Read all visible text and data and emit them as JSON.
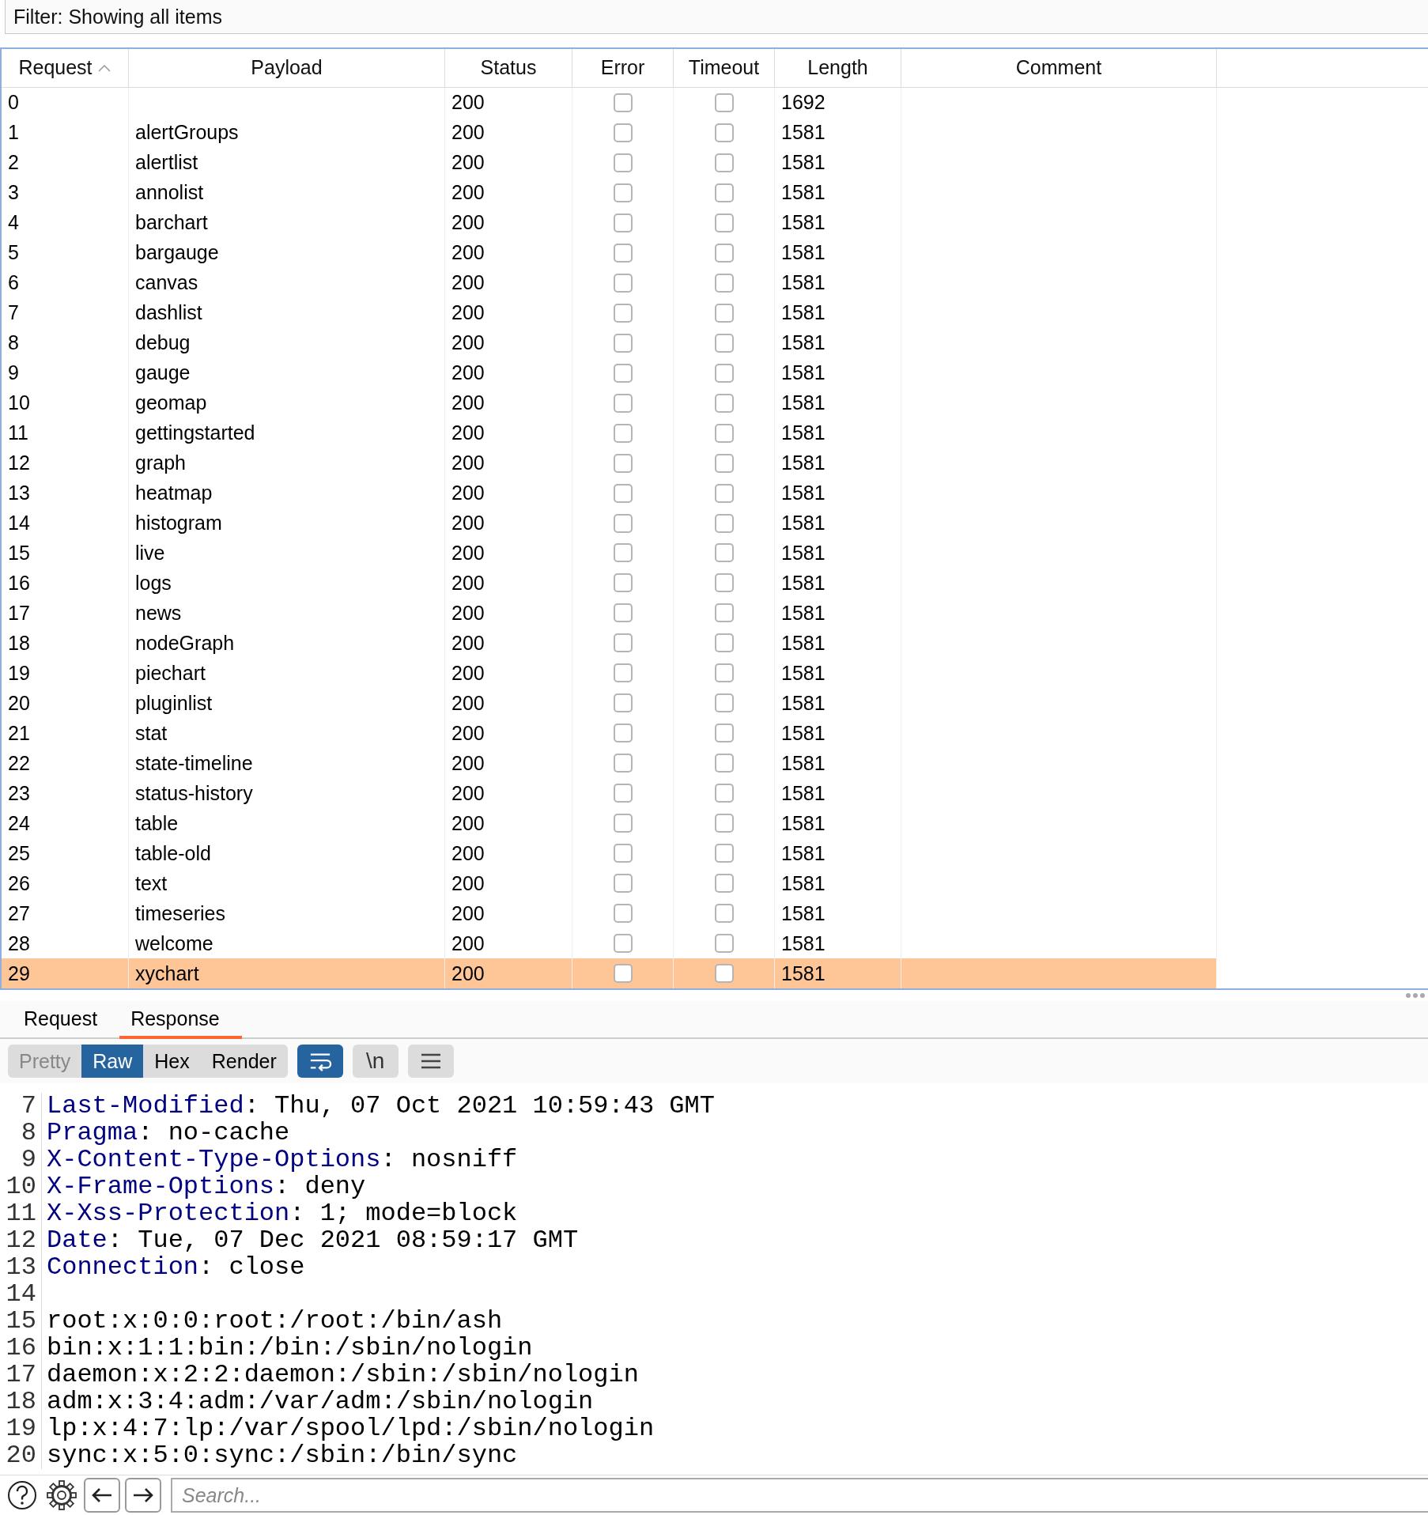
{
  "filter": {
    "label": "Filter: Showing all items"
  },
  "table": {
    "columns": [
      {
        "label": "Request",
        "sorted": true
      },
      {
        "label": "Payload",
        "sorted": false
      },
      {
        "label": "Status",
        "sorted": false
      },
      {
        "label": "Error",
        "sorted": false
      },
      {
        "label": "Timeout",
        "sorted": false
      },
      {
        "label": "Length",
        "sorted": false
      },
      {
        "label": "Comment",
        "sorted": false
      }
    ],
    "rows": [
      {
        "request": "0",
        "payload": "",
        "status": "200",
        "error": false,
        "timeout": false,
        "length": "1692",
        "selected": false
      },
      {
        "request": "1",
        "payload": "alertGroups",
        "status": "200",
        "error": false,
        "timeout": false,
        "length": "1581",
        "selected": false
      },
      {
        "request": "2",
        "payload": "alertlist",
        "status": "200",
        "error": false,
        "timeout": false,
        "length": "1581",
        "selected": false
      },
      {
        "request": "3",
        "payload": "annolist",
        "status": "200",
        "error": false,
        "timeout": false,
        "length": "1581",
        "selected": false
      },
      {
        "request": "4",
        "payload": "barchart",
        "status": "200",
        "error": false,
        "timeout": false,
        "length": "1581",
        "selected": false
      },
      {
        "request": "5",
        "payload": "bargauge",
        "status": "200",
        "error": false,
        "timeout": false,
        "length": "1581",
        "selected": false
      },
      {
        "request": "6",
        "payload": "canvas",
        "status": "200",
        "error": false,
        "timeout": false,
        "length": "1581",
        "selected": false
      },
      {
        "request": "7",
        "payload": "dashlist",
        "status": "200",
        "error": false,
        "timeout": false,
        "length": "1581",
        "selected": false
      },
      {
        "request": "8",
        "payload": "debug",
        "status": "200",
        "error": false,
        "timeout": false,
        "length": "1581",
        "selected": false
      },
      {
        "request": "9",
        "payload": "gauge",
        "status": "200",
        "error": false,
        "timeout": false,
        "length": "1581",
        "selected": false
      },
      {
        "request": "10",
        "payload": "geomap",
        "status": "200",
        "error": false,
        "timeout": false,
        "length": "1581",
        "selected": false
      },
      {
        "request": "11",
        "payload": "gettingstarted",
        "status": "200",
        "error": false,
        "timeout": false,
        "length": "1581",
        "selected": false
      },
      {
        "request": "12",
        "payload": "graph",
        "status": "200",
        "error": false,
        "timeout": false,
        "length": "1581",
        "selected": false
      },
      {
        "request": "13",
        "payload": "heatmap",
        "status": "200",
        "error": false,
        "timeout": false,
        "length": "1581",
        "selected": false
      },
      {
        "request": "14",
        "payload": "histogram",
        "status": "200",
        "error": false,
        "timeout": false,
        "length": "1581",
        "selected": false
      },
      {
        "request": "15",
        "payload": "live",
        "status": "200",
        "error": false,
        "timeout": false,
        "length": "1581",
        "selected": false
      },
      {
        "request": "16",
        "payload": "logs",
        "status": "200",
        "error": false,
        "timeout": false,
        "length": "1581",
        "selected": false
      },
      {
        "request": "17",
        "payload": "news",
        "status": "200",
        "error": false,
        "timeout": false,
        "length": "1581",
        "selected": false
      },
      {
        "request": "18",
        "payload": "nodeGraph",
        "status": "200",
        "error": false,
        "timeout": false,
        "length": "1581",
        "selected": false
      },
      {
        "request": "19",
        "payload": "piechart",
        "status": "200",
        "error": false,
        "timeout": false,
        "length": "1581",
        "selected": false
      },
      {
        "request": "20",
        "payload": "pluginlist",
        "status": "200",
        "error": false,
        "timeout": false,
        "length": "1581",
        "selected": false
      },
      {
        "request": "21",
        "payload": "stat",
        "status": "200",
        "error": false,
        "timeout": false,
        "length": "1581",
        "selected": false
      },
      {
        "request": "22",
        "payload": "state-timeline",
        "status": "200",
        "error": false,
        "timeout": false,
        "length": "1581",
        "selected": false
      },
      {
        "request": "23",
        "payload": "status-history",
        "status": "200",
        "error": false,
        "timeout": false,
        "length": "1581",
        "selected": false
      },
      {
        "request": "24",
        "payload": "table",
        "status": "200",
        "error": false,
        "timeout": false,
        "length": "1581",
        "selected": false
      },
      {
        "request": "25",
        "payload": "table-old",
        "status": "200",
        "error": false,
        "timeout": false,
        "length": "1581",
        "selected": false
      },
      {
        "request": "26",
        "payload": "text",
        "status": "200",
        "error": false,
        "timeout": false,
        "length": "1581",
        "selected": false
      },
      {
        "request": "27",
        "payload": "timeseries",
        "status": "200",
        "error": false,
        "timeout": false,
        "length": "1581",
        "selected": false
      },
      {
        "request": "28",
        "payload": "welcome",
        "status": "200",
        "error": false,
        "timeout": false,
        "length": "1581",
        "selected": false
      },
      {
        "request": "29",
        "payload": "xychart",
        "status": "200",
        "error": false,
        "timeout": false,
        "length": "1581",
        "selected": true
      }
    ]
  },
  "message_tabs": [
    {
      "label": "Request",
      "selected": false
    },
    {
      "label": "Response",
      "selected": true
    }
  ],
  "view_modes": [
    {
      "label": "Pretty",
      "selected": false,
      "disabled": true
    },
    {
      "label": "Raw",
      "selected": true,
      "disabled": false
    },
    {
      "label": "Hex",
      "selected": false,
      "disabled": false
    },
    {
      "label": "Render",
      "selected": false,
      "disabled": false
    }
  ],
  "view_toggles": [
    {
      "kind": "wrap",
      "on": true
    },
    {
      "kind": "newline",
      "label": "\\n",
      "on": false
    },
    {
      "kind": "menu",
      "on": false
    }
  ],
  "code_lines": [
    {
      "number": "7",
      "key": "Last-Modified",
      "text": ": Thu, 07 Oct 2021 10:59:43 GMT"
    },
    {
      "number": "8",
      "key": "Pragma",
      "text": ": no-cache"
    },
    {
      "number": "9",
      "key": "X-Content-Type-Options",
      "text": ": nosniff"
    },
    {
      "number": "10",
      "key": "X-Frame-Options",
      "text": ": deny"
    },
    {
      "number": "11",
      "key": "X-Xss-Protection",
      "text": ": 1; mode=block"
    },
    {
      "number": "12",
      "key": "Date",
      "text": ": Tue, 07 Dec 2021 08:59:17 GMT"
    },
    {
      "number": "13",
      "key": "Connection",
      "text": ": close"
    },
    {
      "number": "14"
    },
    {
      "number": "15",
      "text": "root:x:0:0:root:/root:/bin/ash"
    },
    {
      "number": "16",
      "text": "bin:x:1:1:bin:/bin:/sbin/nologin"
    },
    {
      "number": "17",
      "text": "daemon:x:2:2:daemon:/sbin:/sbin/nologin"
    },
    {
      "number": "18",
      "text": "adm:x:3:4:adm:/var/adm:/sbin/nologin"
    },
    {
      "number": "19",
      "text": "lp:x:4:7:lp:/var/spool/lpd:/sbin/nologin"
    },
    {
      "number": "20",
      "text": "sync:x:5:0:sync:/sbin:/bin/sync"
    }
  ],
  "search": {
    "placeholder": "Search..."
  }
}
